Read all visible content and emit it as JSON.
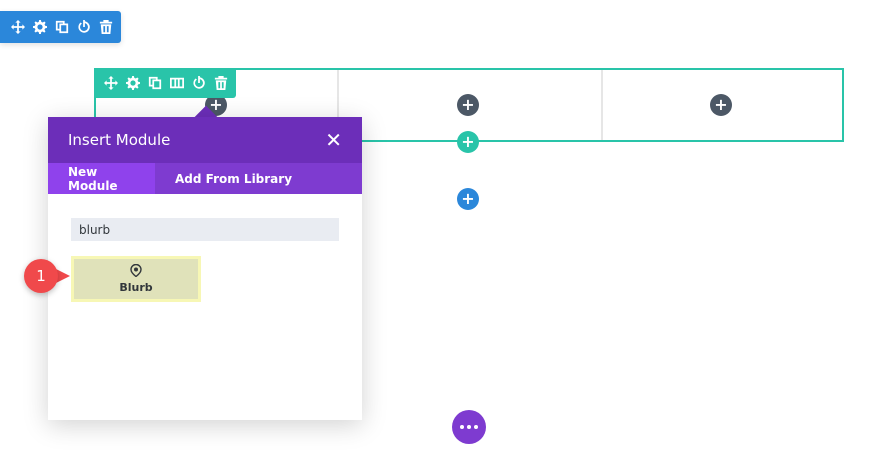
{
  "section_toolbar": {
    "icons": [
      "move-icon",
      "gear-icon",
      "duplicate-icon",
      "power-icon",
      "trash-icon"
    ],
    "color": "#2b87da"
  },
  "row_toolbar": {
    "icons": [
      "move-icon",
      "gear-icon",
      "duplicate-icon",
      "columns-icon",
      "power-icon",
      "trash-icon"
    ],
    "color": "#29c4a9"
  },
  "add_buttons": {
    "symbol": "+"
  },
  "modal": {
    "title": "Insert Module",
    "close": "✕",
    "tabs": [
      {
        "label": "New Module",
        "active": true
      },
      {
        "label": "Add From Library",
        "active": false
      }
    ],
    "search_value": "blurb",
    "modules": [
      {
        "label": "Blurb",
        "icon": "blurb-icon"
      }
    ],
    "header_color": "#6c2eb9",
    "tab_color": "#7e3bd0"
  },
  "callout": {
    "number": "1",
    "color": "#f0494b"
  }
}
